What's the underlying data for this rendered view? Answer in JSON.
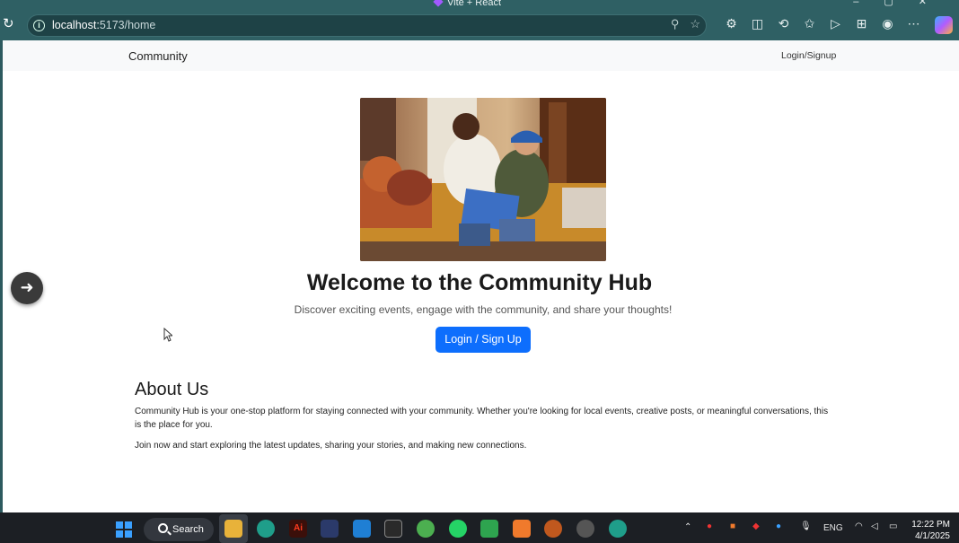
{
  "browser": {
    "tab_title": "Vite + React",
    "url_host": "localhost:",
    "url_path": "5173/home",
    "window_controls": [
      "–",
      "▢",
      "✕"
    ],
    "toolbar_icons": [
      "extensions-icon",
      "split-screen-icon",
      "history-icon",
      "favorites-icon",
      "send-icon",
      "collections-icon",
      "profile-icon",
      "more-icon"
    ]
  },
  "navbar": {
    "brand": "Community",
    "login_link": "Login/Signup"
  },
  "hero": {
    "title": "Welcome to the Community Hub",
    "subtitle": "Discover exciting events, engage with the community, and share your thoughts!",
    "cta_label": "Login / Sign Up"
  },
  "about": {
    "heading": "About Us",
    "paragraph1": "Community Hub is your one-stop platform for staying connected with your community. Whether you're looking for local events, creative posts, or meaningful conversations, this is the place for you.",
    "paragraph2": "Join now and start exploring the latest updates, sharing your stories, and making new connections."
  },
  "taskbar": {
    "search_label": "Search",
    "language": "ENG",
    "time": "12:22 PM",
    "date": "4/1/2025"
  },
  "colors": {
    "primary_button": "#0d6efd",
    "browser_chrome": "#2f6064",
    "navbar_bg": "#f8f9fa"
  }
}
